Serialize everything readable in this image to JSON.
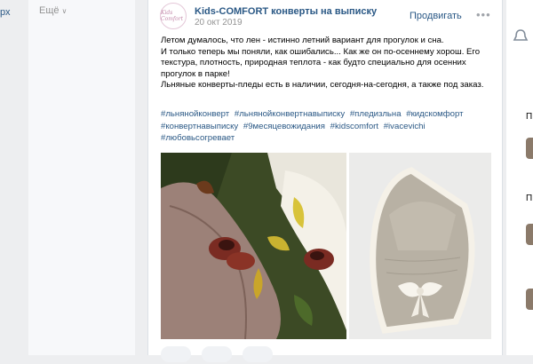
{
  "left_nav": {
    "fragment": "рх"
  },
  "sidebar": {
    "more_label": "Ещё"
  },
  "post": {
    "avatar_text": "Kids Comfort",
    "author": "Kids-COMFORT конверты на выписку",
    "date": "20 окт 2019",
    "promote_label": "Продвигать",
    "more_label": "•••",
    "text_lines": [
      "Летом думалось, что лен - истинно летний вариант для прогулок и сна.",
      "И только теперь мы поняли, как ошибались... Как же он по-осеннему хорош. Его текстура, плотность, природная теплота - как будто специально для осенних прогулок в парке!",
      "Льняные конверты-пледы есть в наличии, сегодня-на-сегодня, а также под заказ."
    ],
    "hashtags": [
      "#льнянойконверт",
      "#льнянойконвертнавыписку",
      "#пледизльна",
      "#кидскомфорт",
      "#конвертнавыписку",
      "#9месяцевожидания",
      "#kidscomfort",
      "#ivacevichi",
      "#любовьсогревает"
    ]
  },
  "right_col": {
    "letters": [
      "П",
      "П"
    ]
  },
  "colors": {
    "link": "#2a5885",
    "muted": "#939393",
    "background": "#edeef0"
  },
  "icons": [
    "chevron-down-icon",
    "more-dots-icon",
    "like-icon",
    "comment-icon",
    "share-icon",
    "bell-icon"
  ]
}
